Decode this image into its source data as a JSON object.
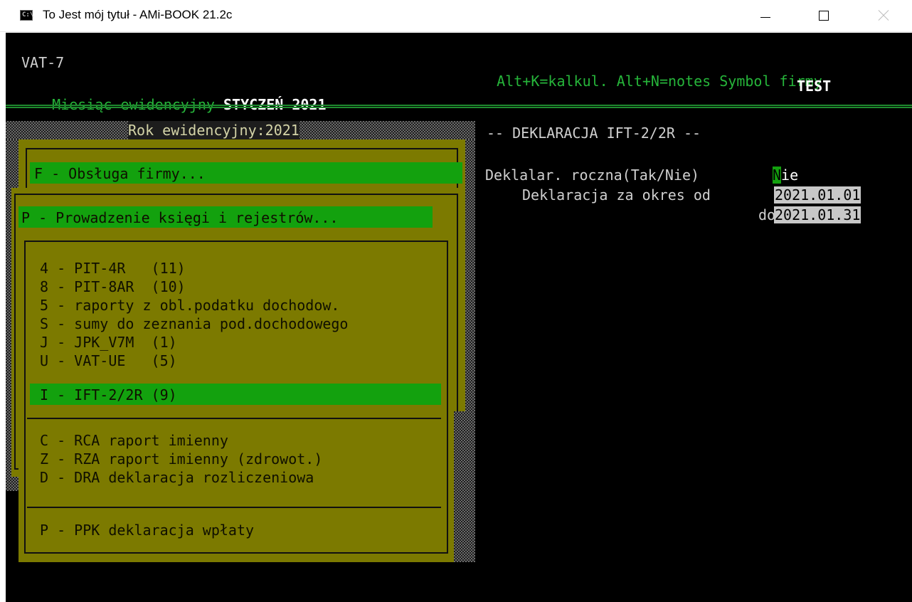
{
  "window": {
    "icon_text": "C:\\",
    "title": "To Jest mój tytuł - AMi-BOOK 21.2c",
    "controls": [
      "minimize-icon",
      "maximize-icon",
      "close-icon"
    ]
  },
  "header": {
    "module": "VAT-7",
    "month_label": "Miesiąc ewidencyjny",
    "month_value": "STYCZEŃ 2021",
    "hotkeys": "Alt+K=kalkul. Alt+N=notes",
    "company_label": "Symbol firmy",
    "company_value": "TEST"
  },
  "year_label": "Rok ewidencyjny:2021",
  "menu_firm": {
    "label": "F - Obsługa firmy..."
  },
  "menu_ledger": {
    "label": "P - Prowadzenie księgi i rejestrów..."
  },
  "submenu": {
    "group1": [
      "4 - PIT-4R   (11)",
      "8 - PIT-8AR  (10)",
      "5 - raporty z obl.podatku dochodow.",
      "S - sumy do zeznania pod.dochodowego",
      "J - JPK_V7M  (1)",
      "U - VAT-UE   (5)",
      "I - IFT-2/2R (9)"
    ],
    "selected_index": 6,
    "group2": [
      "C - RCA raport imienny",
      "Z - RZA raport imienny (zdrowot.)",
      "D - DRA deklaracja rozliczeniowa"
    ],
    "group3": [
      "P - PPK deklaracja wpłaty"
    ]
  },
  "declaration": {
    "title": "-- DEKLARACJA IFT-2/2R --",
    "annual_label": "Deklalar. roczna(Tak/Nie)",
    "annual_value_first": "N",
    "annual_value_rest": "ie",
    "period_from_label": "Deklaracja za okres od",
    "period_from_value": "2021.01.01",
    "period_to_label": "do",
    "period_to_value": "2021.01.31"
  },
  "colors": {
    "console_bg": "#000000",
    "green_text": "#26b53a",
    "olive_panel": "#7c7a00",
    "highlight": "#13a10e",
    "field_bg": "#c8c8c8"
  }
}
